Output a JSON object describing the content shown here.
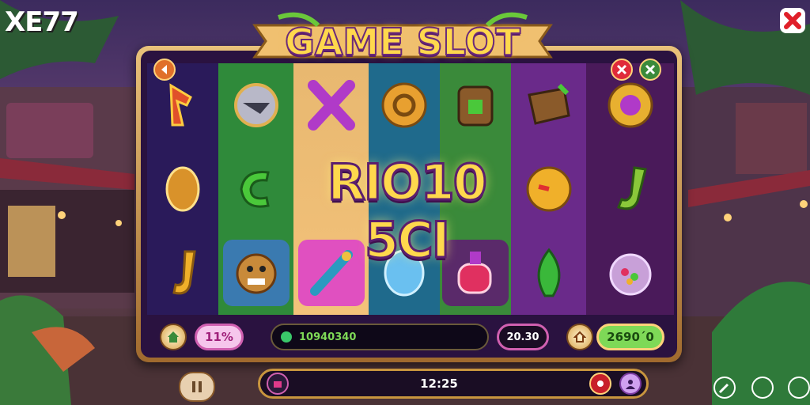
{
  "brand": {
    "logo_text": "XE77"
  },
  "title_banner": {
    "text": "GAME SLOT"
  },
  "win_text": "RIO10 5CI",
  "reels": [
    {
      "symbols": [
        "red-bracket-symbol",
        "amber-gem-symbol",
        "gold-j-symbol"
      ],
      "bg": "#3a1e6a"
    },
    {
      "symbols": [
        "silver-helmet-symbol",
        "green-c-symbol",
        "goblin-face-symbol"
      ],
      "bg": "#2f8a3a"
    },
    {
      "symbols": [
        "purple-x-symbol",
        "blank",
        "jeweled-sword-symbol"
      ],
      "bg": "#f3c27a"
    },
    {
      "symbols": [
        "gold-coin-symbol",
        "blank",
        "blue-gem-symbol"
      ],
      "bg": "#1f6a8c"
    },
    {
      "symbols": [
        "bronze-chest-symbol",
        "blank",
        "red-potion-symbol"
      ],
      "bg": "#3a8a3a"
    },
    {
      "symbols": [
        "treasure-box-symbol",
        "gold-clock-symbol",
        "green-leaf-symbol"
      ],
      "bg": "#6a2a8a"
    },
    {
      "symbols": [
        "purple-orb-coin-symbol",
        "green-j-symbol",
        "candy-jar-symbol"
      ],
      "bg": "#4a1a5a"
    }
  ],
  "hud": {
    "percent": "11%",
    "balance": "10940340",
    "bet": "20.30",
    "win_value": "2690´0"
  },
  "bottom_bar": {
    "time": "12:25"
  },
  "colors": {
    "frame_gold": "#e9c27a",
    "hud_bg": "#2a1240",
    "accent_green": "#7ed957",
    "accent_pink": "#f06ad0",
    "brand_red": "#e0202a"
  }
}
